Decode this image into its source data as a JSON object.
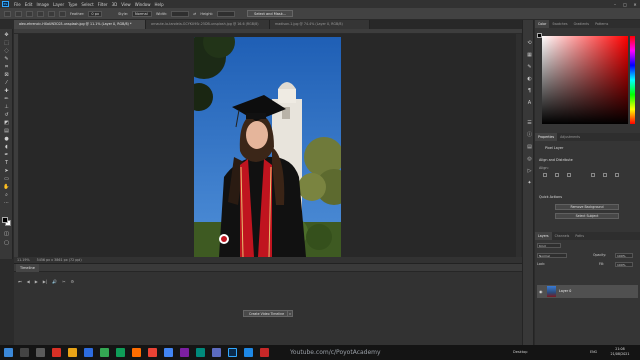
{
  "app": {
    "name": "Ps"
  },
  "menu": [
    "File",
    "Edit",
    "Image",
    "Layer",
    "Type",
    "Select",
    "Filter",
    "3D",
    "View",
    "Window",
    "Help"
  ],
  "window_controls": [
    "–",
    "□",
    "✕"
  ],
  "options_bar": {
    "feather_label": "Feather:",
    "feather_value": "0 px",
    "style_label": "Style:",
    "style_value": "Normal",
    "width_label": "Width:",
    "height_label": "Height:",
    "select_mask_button": "Select and Mask..."
  },
  "tabs": [
    {
      "label": "alex-ehrencic-HXoUN3C03-unsplash.jpg @ 11.1% (Layer 0, RGB/8) *",
      "active": true
    },
    {
      "label": "arnaute-la-tandela-GCYKU9Sr-25DB-unsplash.jpg @ 16.6 (RGB/8)",
      "active": false
    },
    {
      "label": "madison-1.jpg @ 74.4% (Layer 0, RGB/8)",
      "active": false
    }
  ],
  "status_bar": {
    "zoom": "11.19%",
    "doc_info": "5456 px x 3861 px (72 ppi)"
  },
  "timeline": {
    "title": "Timeline",
    "controls": [
      "⏮",
      "◀",
      "▶",
      "▶|",
      "🔊",
      "✂",
      "⚙"
    ],
    "create_button": "Create Video Timeline",
    "dropdown_glyph": "▾"
  },
  "right_panel": {
    "color_tabs": [
      "Color",
      "Swatches",
      "Gradients",
      "Patterns"
    ],
    "properties_tabs": [
      "Properties",
      "Adjustments"
    ],
    "pixel_layer_label": "Pixel Layer",
    "align_heading": "Align and Distribute",
    "align_sub": "Align:",
    "quick_actions_heading": "Quick Actions",
    "remove_background": "Remove Background",
    "select_subject": "Select Subject",
    "layers_tabs": [
      "Layers",
      "Channels",
      "Paths"
    ],
    "layers_kind": "Kind",
    "blend_mode": "Normal",
    "opacity_label": "Opacity:",
    "opacity_value": "100%",
    "lock_label": "Lock:",
    "fill_label": "Fill:",
    "fill_value": "100%",
    "layer_name": "Layer 0"
  },
  "taskbar": {
    "watermark": "Youtube.com/c/PoyotAcademy",
    "desktop": "Desktop",
    "lang": "ENG",
    "time": "21:08",
    "date": "21/08/2021"
  }
}
